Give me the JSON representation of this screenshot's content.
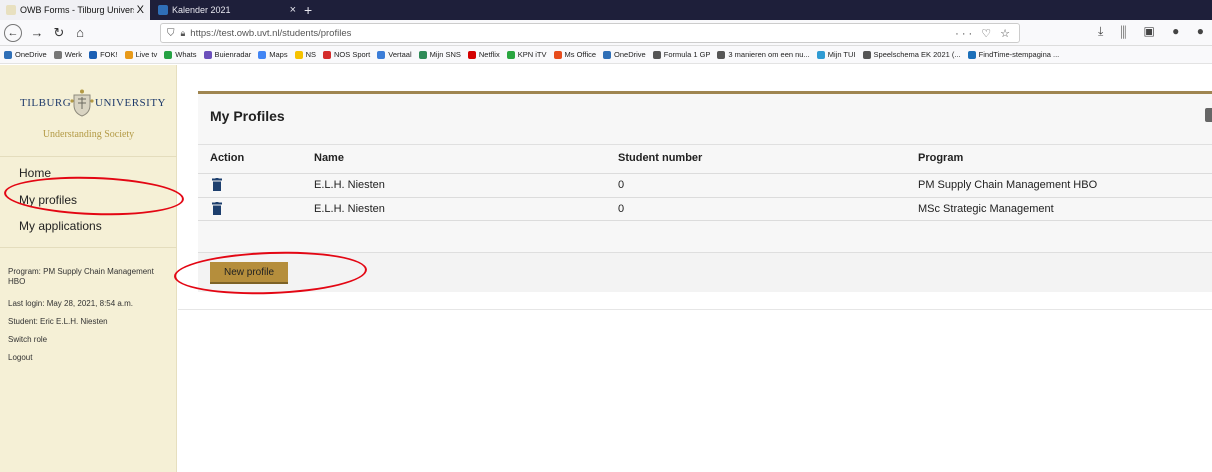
{
  "browser": {
    "tabs": [
      {
        "label": "OWB Forms - Tilburg University",
        "close": "X",
        "active": true
      },
      {
        "label": "Kalender 2021",
        "close": "×",
        "active": false
      }
    ],
    "new_tab": "+",
    "url": "https://test.owb.uvt.nl/students/profiles",
    "url_extras": "··· ♡ ☆",
    "bookmarks": [
      "OneDrive",
      "Werk",
      "FOK!",
      "Live tv",
      "Whats",
      "Buienradar",
      "Maps",
      "NS",
      "NOS Sport",
      "Vertaal",
      "Mijn SNS",
      "Netflix",
      "KPN iTV",
      "Ms Office",
      "OneDrive",
      "Formula 1 GP",
      "3 manieren om een nu...",
      "Mijn TUI",
      "Speelschema EK 2021 (...",
      "FindTime-stempagina ..."
    ]
  },
  "sidebar": {
    "logo": {
      "left": "Tilburg",
      "right": "University",
      "subtitle": "Understanding Society"
    },
    "nav": {
      "home": "Home",
      "profiles": "My profiles",
      "applications": "My applications"
    },
    "meta": {
      "program": "Program: PM Supply Chain Management HBO",
      "last_login": "Last login: May 28, 2021, 8:54 a.m.",
      "student": "Student: Eric E.L.H. Niesten",
      "switch_role": "Switch role",
      "logout": "Logout"
    }
  },
  "main": {
    "title": "My Profiles",
    "columns": {
      "action": "Action",
      "name": "Name",
      "student_number": "Student number",
      "program": "Program"
    },
    "rows": [
      {
        "name": "E.L.H. Niesten",
        "student_number": "0",
        "program": "PM Supply Chain Management HBO"
      },
      {
        "name": "E.L.H. Niesten",
        "student_number": "0",
        "program": "MSc Strategic Management"
      }
    ],
    "new_profile_label": "New profile"
  },
  "colors": {
    "accent_gold": "#b58e3c",
    "sidebar_bg": "#f5f0d6",
    "annotation_red": "#e30613",
    "trash_blue": "#1d3f6e"
  }
}
